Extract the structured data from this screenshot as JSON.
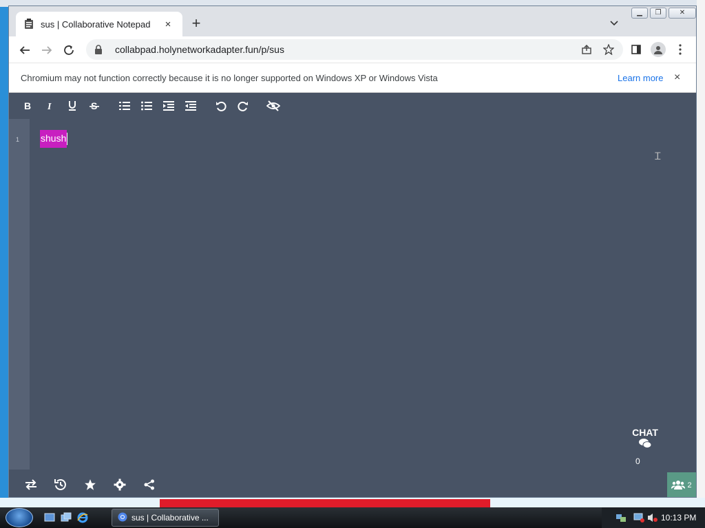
{
  "browser": {
    "tab_title": "sus | Collaborative Notepad",
    "tab_close": "×",
    "new_tab": "+",
    "url": "collabpad.holynetworkadapter.fun/p/sus"
  },
  "infobar": {
    "message": "Chromium may not function correctly because it is no longer supported on Windows XP or Windows Vista",
    "learn_more": "Learn more",
    "close": "×"
  },
  "pad": {
    "line_number": "1",
    "text": "shush",
    "highlight_color": "#c81fc0",
    "background": "#485365"
  },
  "chat": {
    "label": "CHAT",
    "count": "0"
  },
  "users": {
    "count": "2"
  },
  "taskbar": {
    "item_label": "sus | Collaborative ...",
    "clock": "10:13 PM"
  }
}
